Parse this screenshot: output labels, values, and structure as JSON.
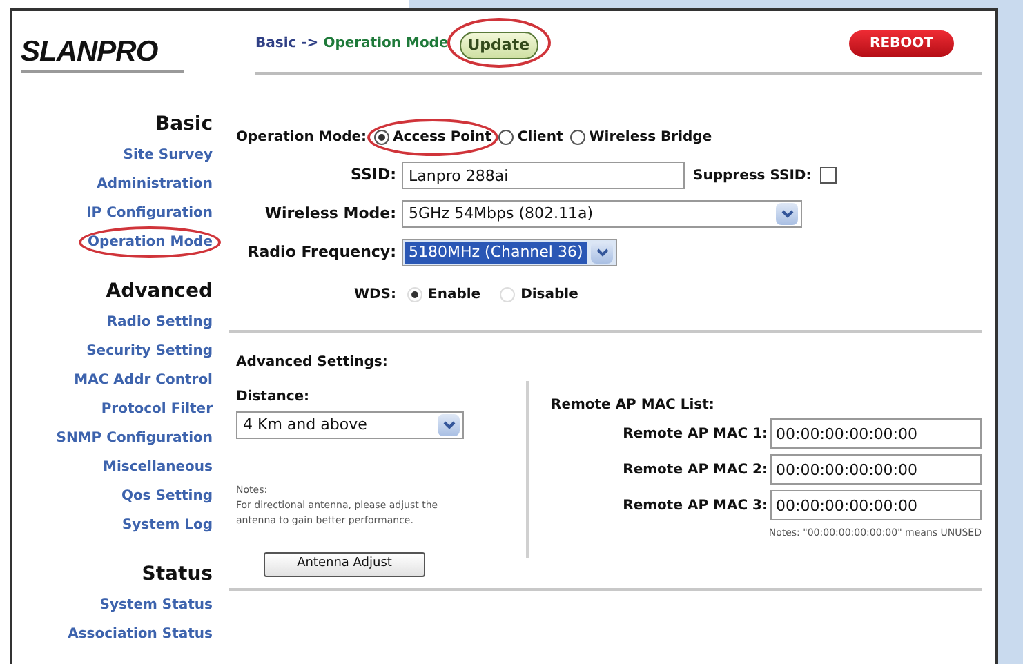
{
  "logo": {
    "text": "SLANPRO"
  },
  "header": {
    "breadcrumb_parent": "Basic ->",
    "breadcrumb_current": "Operation Mode",
    "update": {
      "label": "Update",
      "annotated": true
    },
    "reboot": {
      "label": "REBOOT"
    }
  },
  "sidebar": {
    "sections": [
      {
        "title": "Basic",
        "items": [
          {
            "label": "Site Survey",
            "annotated": false
          },
          {
            "label": "Administration",
            "annotated": false
          },
          {
            "label": "IP Configuration",
            "annotated": false
          },
          {
            "label": "Operation Mode",
            "annotated": true
          }
        ]
      },
      {
        "title": "Advanced",
        "items": [
          {
            "label": "Radio Setting",
            "annotated": false
          },
          {
            "label": "Security Setting",
            "annotated": false
          },
          {
            "label": "MAC Addr Control",
            "annotated": false
          },
          {
            "label": "Protocol Filter",
            "annotated": false
          },
          {
            "label": "SNMP Configuration",
            "annotated": false
          },
          {
            "label": "Miscellaneous",
            "annotated": false
          },
          {
            "label": "Qos Setting",
            "annotated": false
          },
          {
            "label": "System Log",
            "annotated": false
          }
        ]
      },
      {
        "title": "Status",
        "items": [
          {
            "label": "System Status",
            "annotated": false
          },
          {
            "label": "Association Status",
            "annotated": false
          }
        ]
      }
    ]
  },
  "operation_mode": {
    "label": "Operation Mode:",
    "options": [
      {
        "label": "Access Point",
        "selected": true,
        "annotated": true
      },
      {
        "label": "Client",
        "selected": false,
        "annotated": false
      },
      {
        "label": "Wireless Bridge",
        "selected": false,
        "annotated": false
      }
    ]
  },
  "ssid": {
    "label": "SSID:",
    "value": "Lanpro 288ai"
  },
  "suppress_ssid": {
    "label": "Suppress SSID:",
    "checked": false
  },
  "wireless_mode": {
    "label": "Wireless Mode:",
    "value": "5GHz 54Mbps (802.11a)"
  },
  "radio_frequency": {
    "label": "Radio Frequency:",
    "value": "5180MHz (Channel 36)"
  },
  "wds": {
    "label": "WDS:",
    "options": [
      {
        "label": "Enable",
        "selected": true
      },
      {
        "label": "Disable",
        "selected": false
      }
    ]
  },
  "advanced": {
    "title": "Advanced Settings:",
    "distance_label": "Distance:",
    "distance_value": "4 Km and above",
    "notes_label": "Notes:",
    "notes_text": "For directional antenna, please adjust the antenna to gain better performance.",
    "antenna_button": "Antenna Adjust"
  },
  "remote_ap": {
    "title": "Remote AP MAC List:",
    "rows": [
      {
        "label": "Remote AP MAC 1:",
        "value": "00:00:00:00:00:00"
      },
      {
        "label": "Remote AP MAC 2:",
        "value": "00:00:00:00:00:00"
      },
      {
        "label": "Remote AP MAC 3:",
        "value": "00:00:00:00:00:00"
      }
    ],
    "note": "Notes: \"00:00:00:00:00:00\" means UNUSED"
  }
}
